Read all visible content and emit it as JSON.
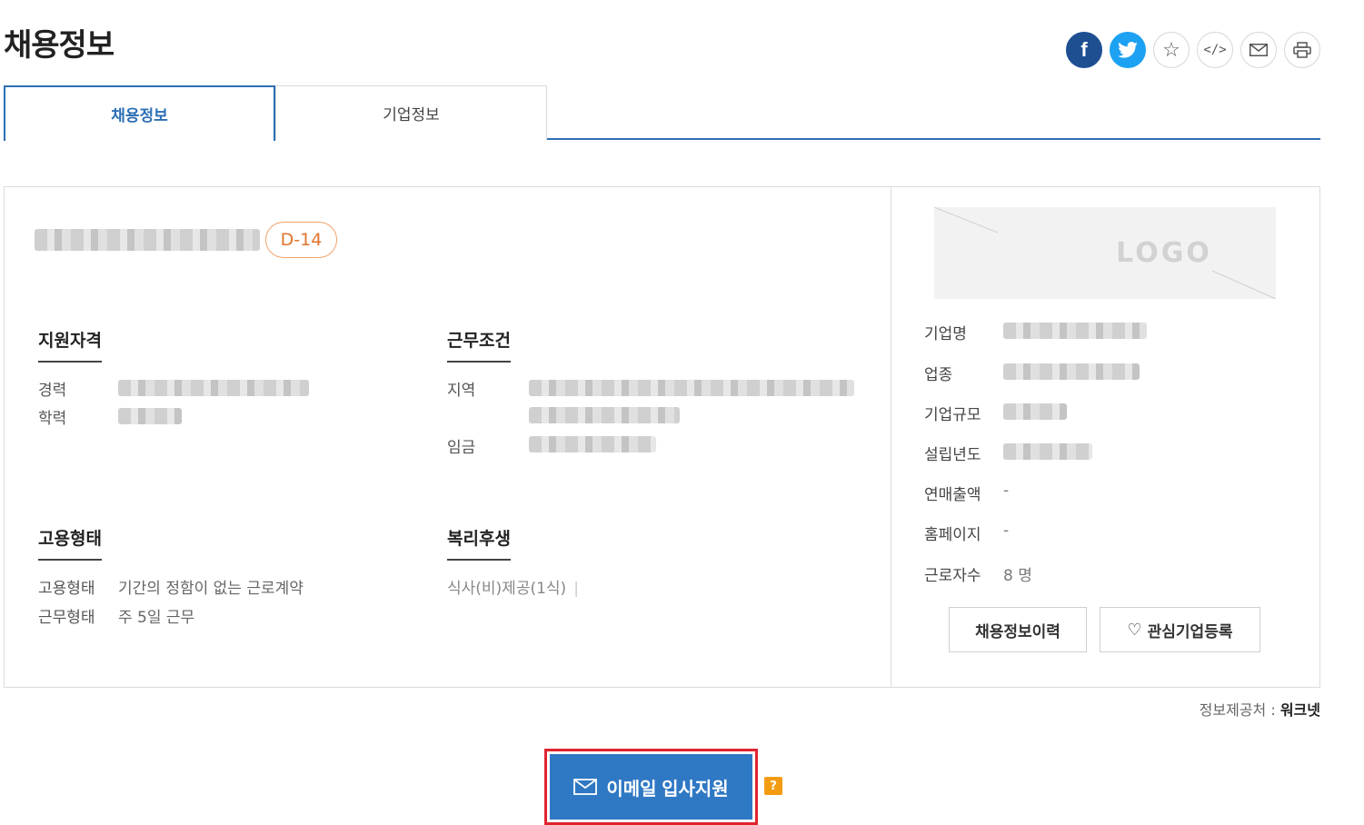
{
  "header": {
    "title": "채용정보"
  },
  "share": [
    {
      "name": "facebook-icon",
      "glyph": "f"
    },
    {
      "name": "twitter-icon",
      "glyph": ""
    },
    {
      "name": "star-icon",
      "glyph": "☆"
    },
    {
      "name": "code-icon",
      "glyph": "</>"
    },
    {
      "name": "mail-icon",
      "glyph": "✉"
    },
    {
      "name": "print-icon",
      "glyph": ""
    }
  ],
  "tabs": [
    {
      "label": "채용정보",
      "active": true
    },
    {
      "label": "기업정보",
      "active": false
    }
  ],
  "job": {
    "dday": "D-14",
    "qualifications": {
      "title": "지원자격",
      "experience_label": "경력",
      "education_label": "학력"
    },
    "conditions": {
      "title": "근무조건",
      "region_label": "지역",
      "salary_label": "임금"
    },
    "employment": {
      "title": "고용형태",
      "type_label": "고용형태",
      "type_value": "기간의 정함이 없는 근로계약",
      "work_label": "근무형태",
      "work_value": "주 5일 근무"
    },
    "welfare": {
      "title": "복리후생",
      "value": "식사(비)제공(1식)"
    }
  },
  "company": {
    "logo_text": "LOGO",
    "name_label": "기업명",
    "industry_label": "업종",
    "size_label": "기업규모",
    "founded_label": "설립년도",
    "revenue_label": "연매출액",
    "revenue_value": "-",
    "homepage_label": "홈페이지",
    "homepage_value": "-",
    "employees_label": "근로자수",
    "employees_value": "8 명",
    "history_button": "채용정보이력",
    "interest_button": "관심기업등록"
  },
  "provider": {
    "label": "정보제공처 :",
    "name": "워크넷"
  },
  "apply": {
    "label": "이메일 입사지원",
    "help": "?"
  },
  "colors": {
    "accent": "#2d6fb6",
    "apply": "#2f78c4",
    "highlight": "#e0242f",
    "dday": "#e0742d"
  }
}
